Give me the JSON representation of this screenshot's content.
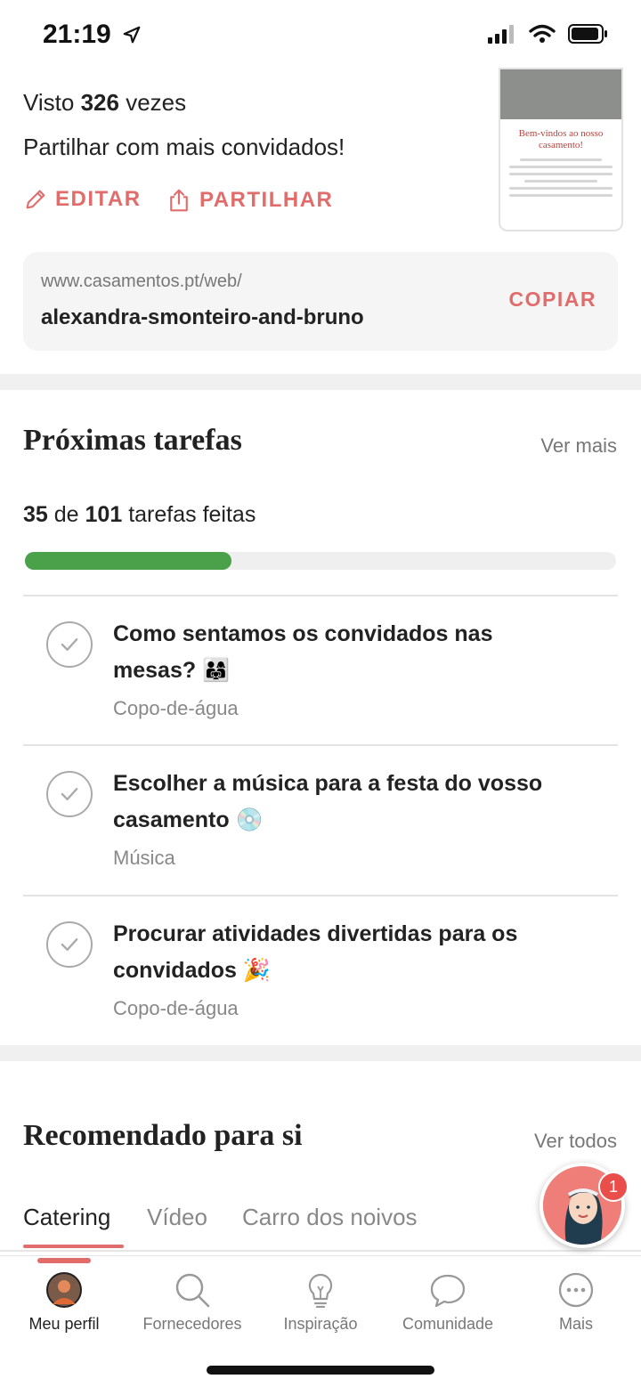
{
  "status_bar": {
    "time": "21:19"
  },
  "website": {
    "views_prefix": "Visto",
    "views_count": "326",
    "views_suffix": "vezes",
    "share_prompt": "Partilhar com mais convidados!",
    "edit_label": "EDITAR",
    "share_label": "PARTILHAR",
    "thumbnail_title": "Bem-vindos ao nosso casamento!",
    "url_prefix": "www.casamentos.pt/web/",
    "url_slug": "alexandra-smonteiro-and-bruno",
    "copy_label": "COPIAR"
  },
  "tasks": {
    "title": "Próximas tarefas",
    "see_more": "Ver mais",
    "done_count": "35",
    "of_word": "de",
    "total_count": "101",
    "done_suffix": "tarefas feitas",
    "progress_fraction": 0.35,
    "items": [
      {
        "title": "Como sentamos os convidados nas mesas? 👨‍👩‍👧",
        "category": "Copo-de-água"
      },
      {
        "title": "Escolher a música para a festa do vosso casamento 💿",
        "category": "Música"
      },
      {
        "title": "Procurar atividades divertidas para os convidados 🎉",
        "category": "Copo-de-água"
      }
    ]
  },
  "recommended": {
    "title": "Recomendado para si",
    "see_all": "Ver todos",
    "tabs": [
      "Catering",
      "Vídeo",
      "Carro dos noivos"
    ],
    "active_tab": "Catering"
  },
  "assistant": {
    "badge_count": "1"
  },
  "bottom_nav": {
    "items": [
      {
        "label": "Meu perfil",
        "icon": "avatar"
      },
      {
        "label": "Fornecedores",
        "icon": "search-icon"
      },
      {
        "label": "Inspiração",
        "icon": "lightbulb-icon"
      },
      {
        "label": "Comunidade",
        "icon": "chat-bubble-icon"
      },
      {
        "label": "Mais",
        "icon": "more-icon"
      }
    ],
    "active": "Meu perfil"
  },
  "colors": {
    "accent": "#e06d6b",
    "progress": "#4aa14a",
    "text": "#222222",
    "muted": "#777777"
  }
}
